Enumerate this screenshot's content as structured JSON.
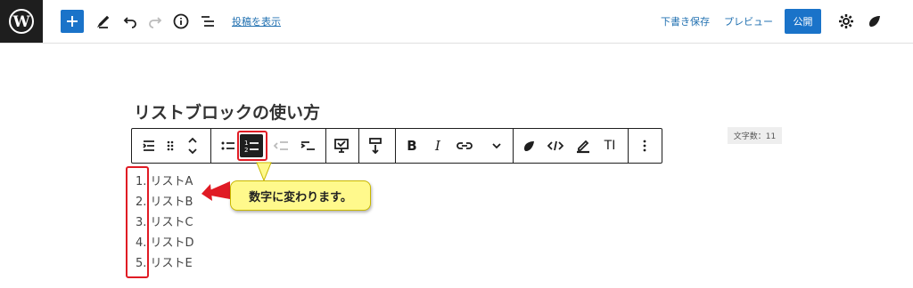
{
  "topbar": {
    "view_post_label": "投稿を表示",
    "save_draft_label": "下書き保存",
    "preview_label": "プレビュー",
    "publish_label": "公開"
  },
  "post": {
    "title": "リストブロックの使い方",
    "word_count": "文字数：11"
  },
  "list": {
    "items": [
      "1. リストA",
      "2. リストB",
      "3. リストC",
      "4. リストD",
      "5. リストE"
    ]
  },
  "annotation": {
    "callout_text": "数字に変わります。"
  },
  "toolbar_icons": [
    "list-block-icon",
    "drag-handle-icon",
    "move-up-down-icon",
    "unordered-list-icon",
    "ordered-list-icon",
    "outdent-icon",
    "indent-icon",
    "reading-mode-icon",
    "paragraph-insert-icon",
    "bold-icon",
    "italic-icon",
    "link-icon",
    "more-chevron-icon",
    "jetpack-icon",
    "code-icon",
    "highlight-icon",
    "text-size-icon",
    "more-options-icon"
  ],
  "colors": {
    "accent": "#1a73c9",
    "annotation_red": "#e01b24",
    "callout_yellow": "#fff98c"
  }
}
